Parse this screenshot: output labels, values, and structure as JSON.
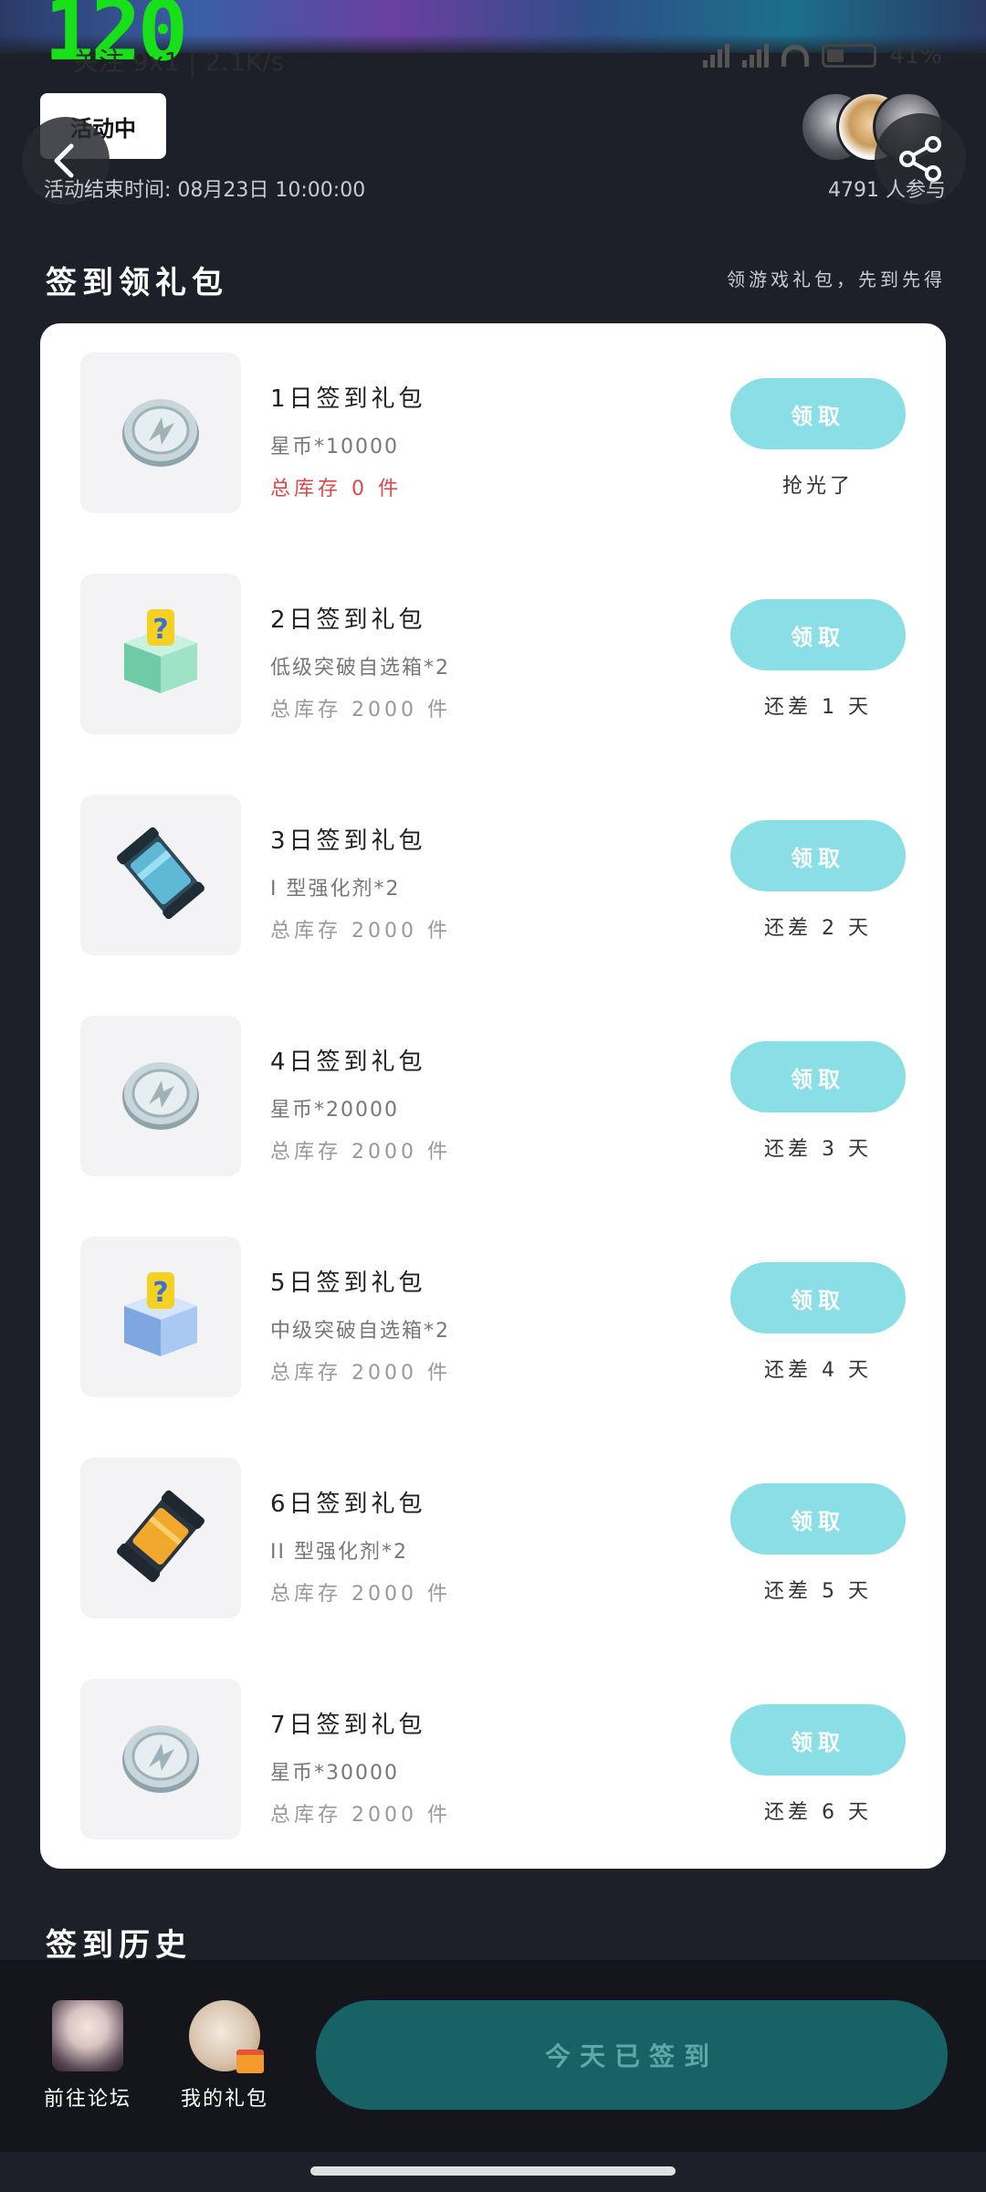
{
  "overlay": {
    "fps": "120"
  },
  "status_bar": {
    "left": "关注 9x1 | 2.1K/s",
    "battery": "41%"
  },
  "header": {
    "status_pill": "活动中",
    "end_time": "活动结束时间: 08月23日 10:00:00",
    "participants": "4791 人参与"
  },
  "signin_section": {
    "title": "签到领礼包",
    "subtitle": "领游戏礼包，先到先得"
  },
  "gifts": [
    {
      "name": "1日签到礼包",
      "reward": "星币*10000",
      "stock": "总库存 0 件",
      "button": "领取",
      "note": "抢光了",
      "icon": "silver-coin-icon"
    },
    {
      "name": "2日签到礼包",
      "reward": "低级突破自选箱*2",
      "stock": "总库存 2000 件",
      "button": "领取",
      "note": "还差 1 天",
      "icon": "green-mystery-box-icon"
    },
    {
      "name": "3日签到礼包",
      "reward": "I 型强化剂*2",
      "stock": "总库存 2000 件",
      "button": "领取",
      "note": "还差 2 天",
      "icon": "blue-canister-icon"
    },
    {
      "name": "4日签到礼包",
      "reward": "星币*20000",
      "stock": "总库存 2000 件",
      "button": "领取",
      "note": "还差 3 天",
      "icon": "silver-coin-icon"
    },
    {
      "name": "5日签到礼包",
      "reward": "中级突破自选箱*2",
      "stock": "总库存 2000 件",
      "button": "领取",
      "note": "还差 4 天",
      "icon": "blue-mystery-box-icon"
    },
    {
      "name": "6日签到礼包",
      "reward": "II 型强化剂*2",
      "stock": "总库存 2000 件",
      "button": "领取",
      "note": "还差 5 天",
      "icon": "orange-canister-icon"
    },
    {
      "name": "7日签到礼包",
      "reward": "星币*30000",
      "stock": "总库存 2000 件",
      "button": "领取",
      "note": "还差 6 天",
      "icon": "silver-coin-icon"
    }
  ],
  "history_section": {
    "title": "签到历史"
  },
  "bottom_bar": {
    "forum_label": "前往论坛",
    "gifts_label": "我的礼包",
    "checkin_button": "今天已签到"
  },
  "colors": {
    "background": "#1d2028",
    "claim_button": "#8adfe6",
    "checkin_button": "#176264",
    "stock_empty": "#e04848"
  }
}
